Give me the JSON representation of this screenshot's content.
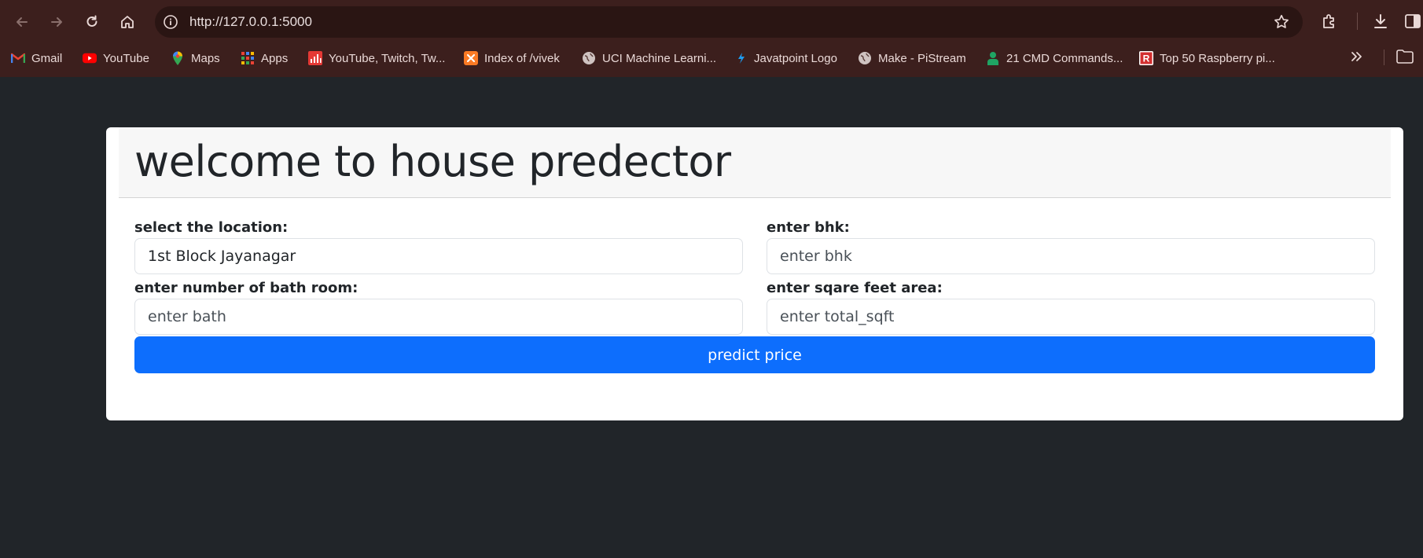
{
  "browser": {
    "url": "http://127.0.0.1:5000",
    "bookmarks": [
      {
        "label": "Gmail",
        "icon": "gmail-icon"
      },
      {
        "label": "YouTube",
        "icon": "youtube-icon"
      },
      {
        "label": "Maps",
        "icon": "maps-icon"
      },
      {
        "label": "Apps",
        "icon": "apps-grid-icon"
      },
      {
        "label": "YouTube, Twitch, Tw...",
        "icon": "chart-icon"
      },
      {
        "label": "Index of /vivek",
        "icon": "xampp-icon"
      },
      {
        "label": "UCI Machine Learni...",
        "icon": "globe-icon"
      },
      {
        "label": "Javatpoint Logo",
        "icon": "javatpoint-icon"
      },
      {
        "label": "Make - PiStream",
        "icon": "globe-icon"
      },
      {
        "label": "21 CMD Commands...",
        "icon": "person-icon"
      },
      {
        "label": "Top 50 Raspberry pi...",
        "icon": "r-logo-icon"
      }
    ]
  },
  "page": {
    "title": "welcome to house predector",
    "location": {
      "label": "select the location:",
      "value": "1st Block Jayanagar"
    },
    "bhk": {
      "label": "enter bhk:",
      "placeholder": "enter bhk"
    },
    "bath": {
      "label": "enter number of bath room:",
      "placeholder": "enter bath"
    },
    "sqft": {
      "label": "enter sqare feet area:",
      "placeholder": "enter total_sqft"
    },
    "button_label": "predict price"
  },
  "colors": {
    "chrome": "#3c1f1d",
    "page_background": "#212529",
    "button": "#0d6efd"
  }
}
